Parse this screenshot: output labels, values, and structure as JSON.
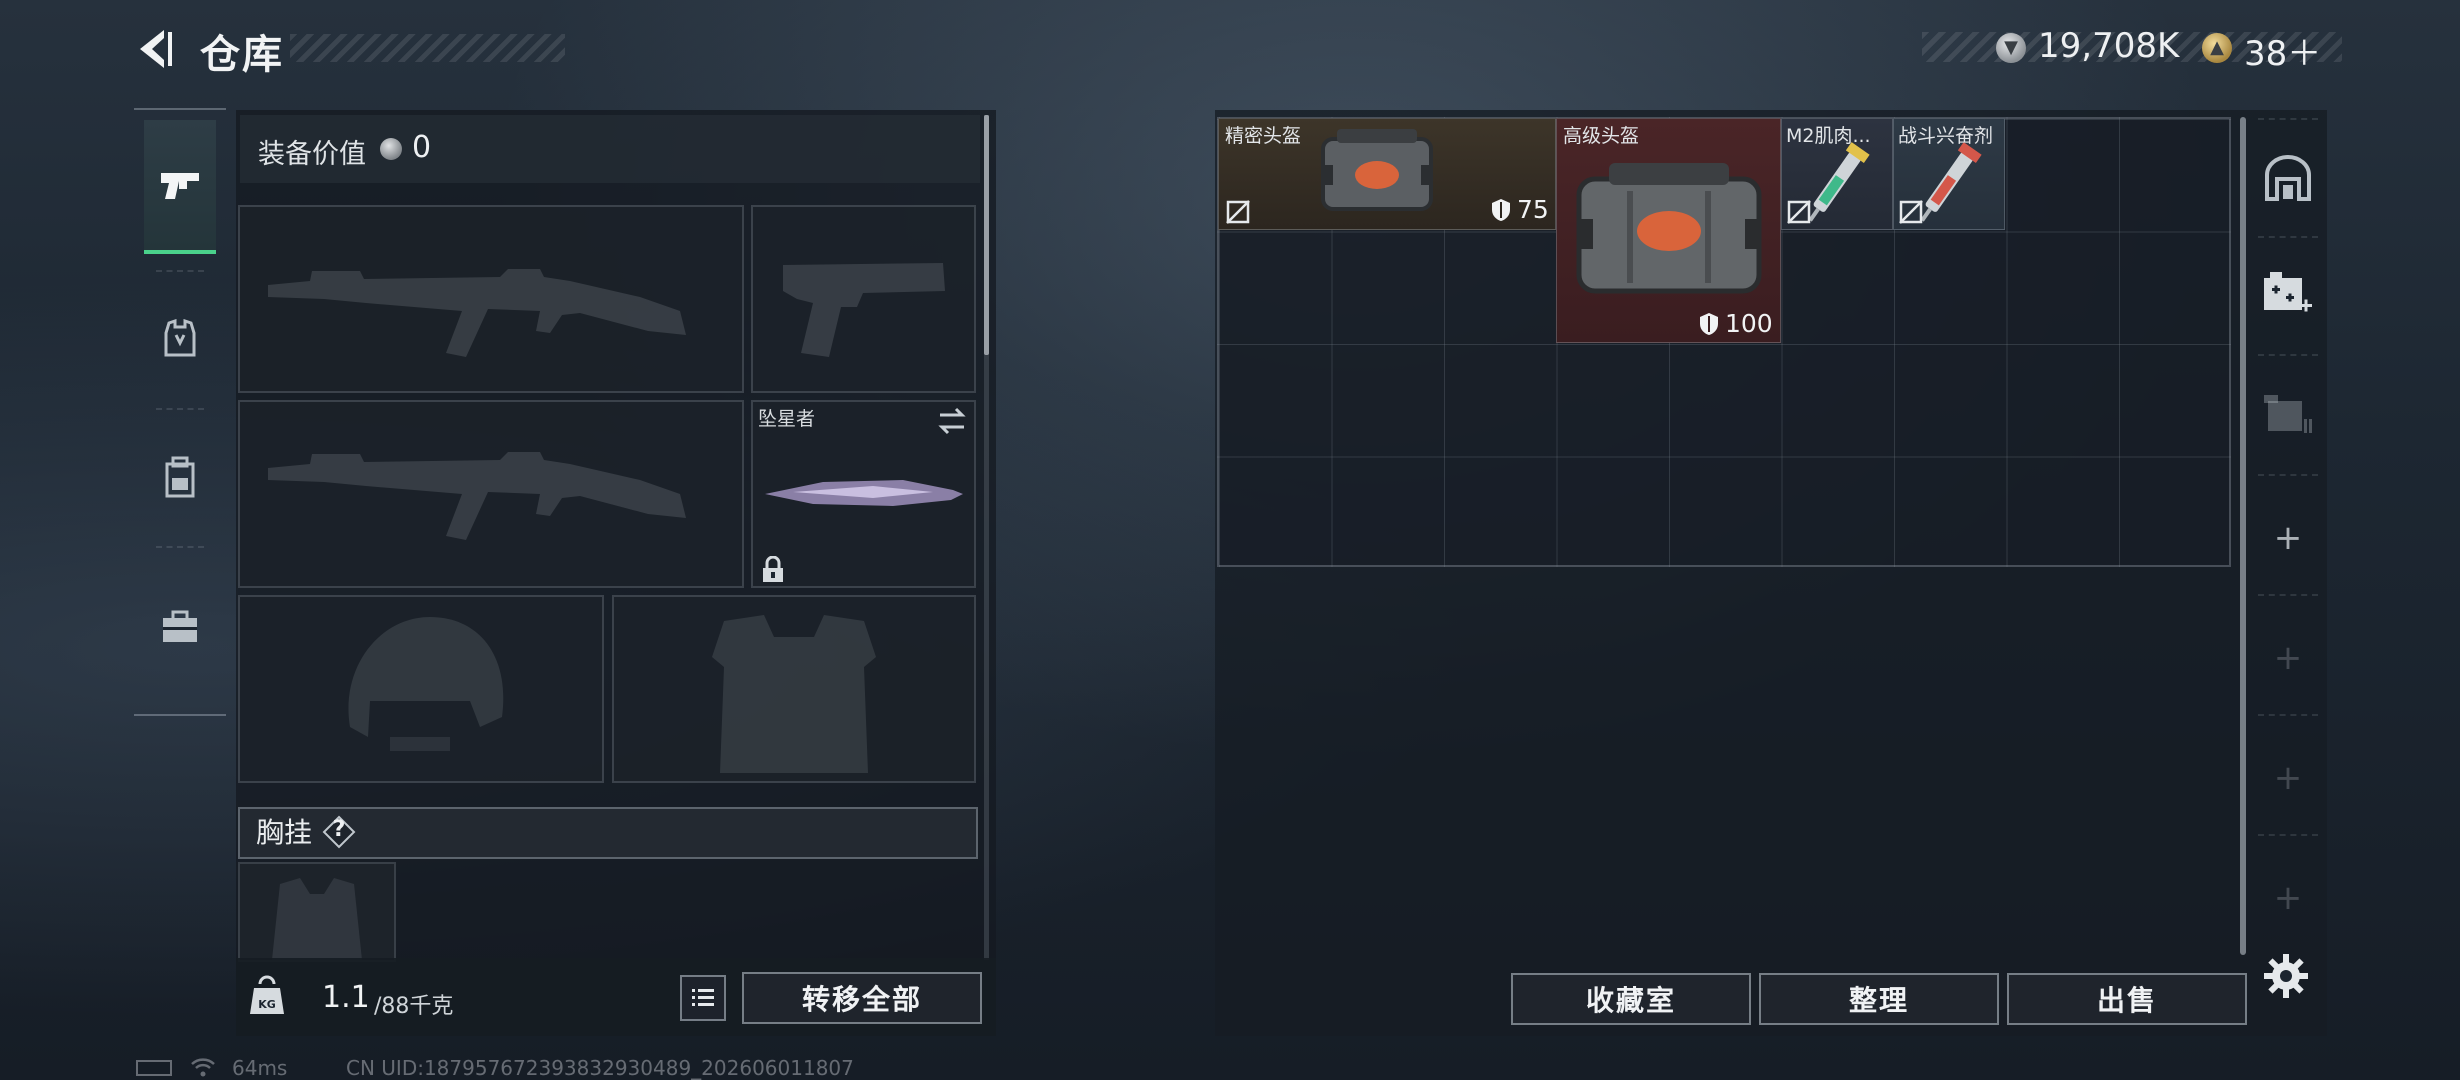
{
  "header": {
    "title": "仓库",
    "currencies": [
      {
        "name": "silver-coin-icon",
        "value": "19,708K"
      },
      {
        "name": "gold-coin-icon",
        "value": "38＋"
      }
    ]
  },
  "loadout": {
    "equip_value_label": "装备价值",
    "equip_value": "0",
    "melee_name": "坠星者",
    "chest_label": "胸挂",
    "chest_help": "?",
    "weight_current": "1.1",
    "weight_max": "/88千克",
    "transfer_all": "转移全部"
  },
  "storage": {
    "items": [
      {
        "name": "精密头盔",
        "armor": "75"
      },
      {
        "name": "高级头盔",
        "armor": "100"
      },
      {
        "name": "M2肌肉..."
      },
      {
        "name": "战斗兴奋剂"
      }
    ],
    "buttons": {
      "collection": "收藏室",
      "sort": "整理",
      "sell": "出售"
    }
  },
  "footer": {
    "ping": "64ms",
    "uid": "CN UID:18795767239383293048​9_202606011807"
  },
  "colors": {
    "active_tab": "#4ad18b",
    "item_common": "#3d3529",
    "item_rare": "#4a2527"
  }
}
